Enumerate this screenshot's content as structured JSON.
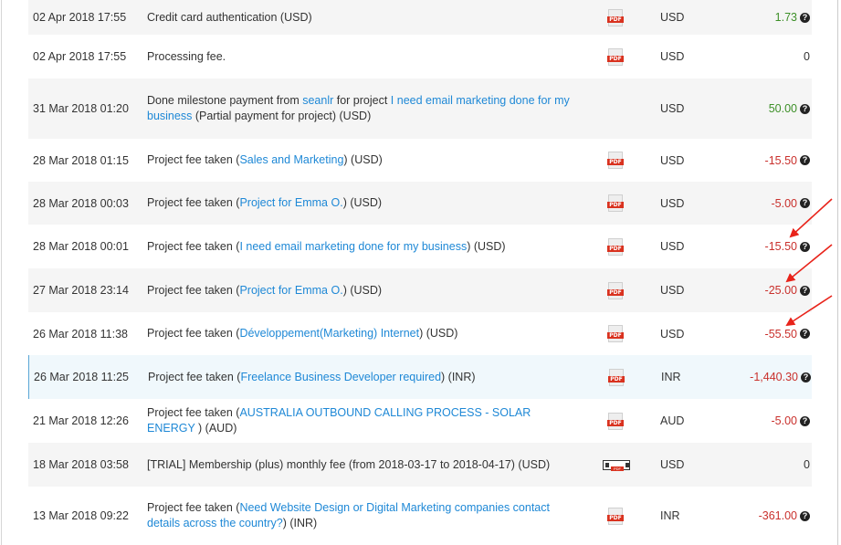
{
  "help_glyph": "?",
  "pdf_label": "PDF",
  "colors": {
    "positive": "#3c8f27",
    "negative": "#c9302c",
    "link": "#1e88d6",
    "arrow": "#e8231a"
  },
  "rows": [
    {
      "date": "02 Apr 2018 17:55",
      "desc": [
        {
          "t": "Credit card authentication (USD)"
        }
      ],
      "pdf": "pdf",
      "currency": "USD",
      "amount": "1.73",
      "sign": "pos",
      "help": true
    },
    {
      "date": "02 Apr 2018 17:55",
      "desc": [
        {
          "t": "Processing fee."
        }
      ],
      "pdf": "pdf",
      "currency": "USD",
      "amount": "0",
      "sign": "zero",
      "help": false
    },
    {
      "date": "31 Mar 2018 01:20",
      "desc": [
        {
          "t": "Done milestone payment from "
        },
        {
          "t": "seanlr",
          "link": true
        },
        {
          "t": " for project "
        },
        {
          "t": "I need email marketing done for my business",
          "link": true
        },
        {
          "t": " (Partial payment for project) (USD)"
        }
      ],
      "pdf": "none",
      "currency": "USD",
      "amount": "50.00",
      "sign": "pos",
      "help": true
    },
    {
      "date": "28 Mar 2018 01:15",
      "desc": [
        {
          "t": "Project fee taken ("
        },
        {
          "t": "Sales and Marketing",
          "link": true
        },
        {
          "t": ") (USD)"
        }
      ],
      "pdf": "pdf",
      "currency": "USD",
      "amount": "-15.50",
      "sign": "neg",
      "help": true
    },
    {
      "date": "28 Mar 2018 00:03",
      "desc": [
        {
          "t": "Project fee taken ("
        },
        {
          "t": "Project for Emma O.",
          "link": true
        },
        {
          "t": ") (USD)"
        }
      ],
      "pdf": "pdf",
      "currency": "USD",
      "amount": "-5.00",
      "sign": "neg",
      "help": true
    },
    {
      "date": "28 Mar 2018 00:01",
      "desc": [
        {
          "t": "Project fee taken ("
        },
        {
          "t": "I need email marketing done for my business",
          "link": true
        },
        {
          "t": ") (USD)"
        }
      ],
      "pdf": "pdf",
      "currency": "USD",
      "amount": "-15.50",
      "sign": "neg",
      "help": true
    },
    {
      "date": "27 Mar 2018 23:14",
      "desc": [
        {
          "t": "Project fee taken ("
        },
        {
          "t": "Project for Emma O.",
          "link": true
        },
        {
          "t": ") (USD)"
        }
      ],
      "pdf": "pdf",
      "currency": "USD",
      "amount": "-25.00",
      "sign": "neg",
      "help": true
    },
    {
      "date": "26 Mar 2018 11:38",
      "desc": [
        {
          "t": "Project fee taken ("
        },
        {
          "t": "Développement(Marketing) Internet",
          "link": true
        },
        {
          "t": ") (USD)"
        }
      ],
      "pdf": "pdf",
      "currency": "USD",
      "amount": "-55.50",
      "sign": "neg",
      "help": true
    },
    {
      "date": "26 Mar 2018 11:25",
      "desc": [
        {
          "t": "Project fee taken ("
        },
        {
          "t": "Freelance Business Developer required",
          "link": true
        },
        {
          "t": ") (INR)"
        }
      ],
      "pdf": "pdf",
      "currency": "INR",
      "amount": "-1,440.30",
      "sign": "neg",
      "help": true
    },
    {
      "date": "21 Mar 2018 12:26",
      "desc": [
        {
          "t": "Project fee taken ("
        },
        {
          "t": "AUSTRALIA OUTBOUND CALLING PROCESS - SOLAR ENERGY ",
          "link": true
        },
        {
          "t": ") (AUD)"
        }
      ],
      "pdf": "pdf",
      "currency": "AUD",
      "amount": "-5.00",
      "sign": "neg",
      "help": true
    },
    {
      "date": "18 Mar 2018 03:58",
      "desc": [
        {
          "t": "[TRIAL] Membership (plus) monthly fee (from 2018-03-17 to 2018-04-17) (USD)"
        }
      ],
      "pdf": "broken",
      "currency": "USD",
      "amount": "0",
      "sign": "zero",
      "help": false
    },
    {
      "date": "13 Mar 2018 09:22",
      "desc": [
        {
          "t": "Project fee taken ("
        },
        {
          "t": "Need Website Design or Digital Marketing companies contact details across the country?",
          "link": true
        },
        {
          "t": ") (INR)"
        }
      ],
      "pdf": "pdf",
      "currency": "INR",
      "amount": "-361.00",
      "sign": "neg",
      "help": true
    }
  ]
}
